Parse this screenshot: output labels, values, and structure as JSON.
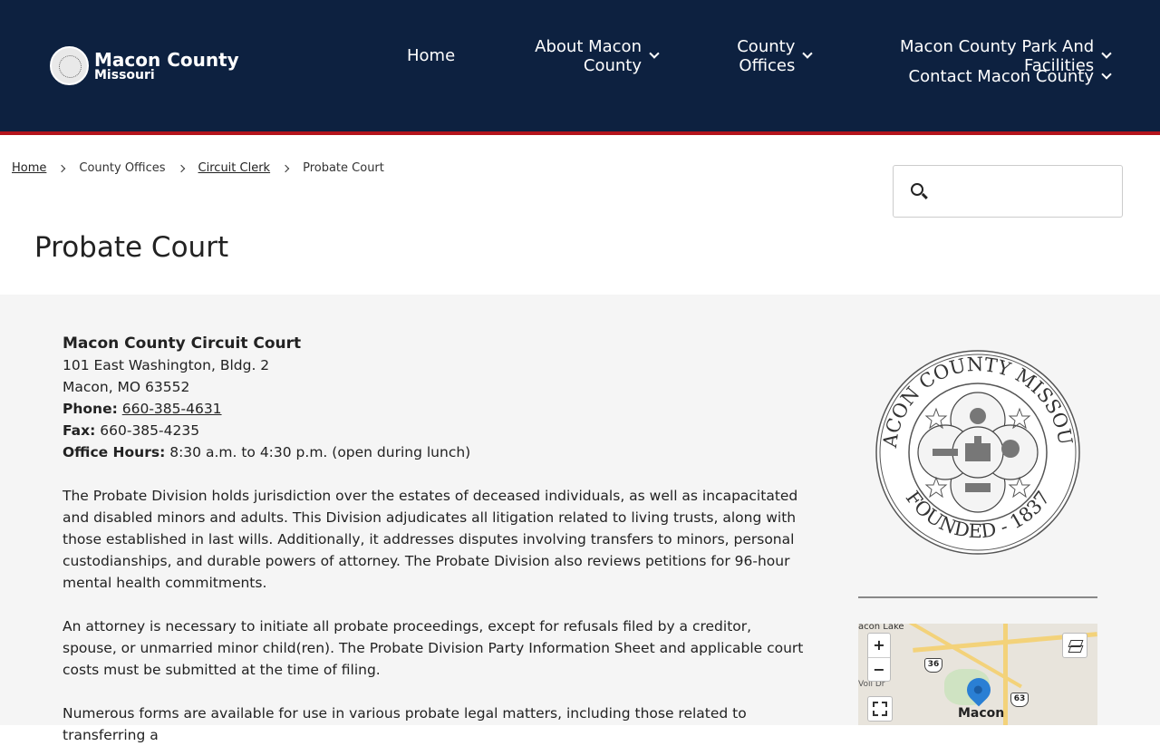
{
  "header": {
    "logo_title": "Macon County",
    "logo_sub": "Missouri",
    "nav_row1": [
      {
        "label": "Home",
        "dropdown": false
      },
      {
        "label": "About Macon County",
        "dropdown": true
      },
      {
        "label": "County Offices",
        "dropdown": true
      },
      {
        "label": "Macon County Park And Facilities",
        "dropdown": true
      }
    ],
    "nav_row2": [
      {
        "label": "Contact Macon County",
        "dropdown": true
      }
    ]
  },
  "breadcrumb": {
    "home": "Home",
    "county_offices": "County Offices",
    "circuit_clerk": "Circuit Clerk",
    "current": "Probate Court"
  },
  "search": {
    "placeholder": "",
    "value": ""
  },
  "page_title": "Probate Court",
  "court": {
    "name": "Macon County Circuit Court",
    "address1": "101 East Washington, Bldg. 2",
    "address2": "Macon, MO 63552",
    "phone_label": "Phone:",
    "phone": "660-385-4631",
    "fax_label": "Fax:",
    "fax": " 660-385-4235",
    "hours_label": "Office Hours:",
    "hours": " 8:30 a.m. to 4:30 p.m. (open during lunch)"
  },
  "paragraphs": [
    "The Probate Division holds jurisdiction over the estates of deceased individuals, as well as incapacitated and disabled minors and adults. This Division adjudicates all litigation related to living trusts, along with those established in last wills. Additionally, it addresses disputes involving transfers to minors, personal custodianships, and durable powers of attorney. The Probate Division also reviews petitions for 96-hour mental health commitments.",
    "An attorney is necessary to initiate all probate proceedings, except for refusals filed by a creditor, spouse, or unmarried minor child(ren). The Probate Division Party Information Sheet and applicable court costs must be submitted at the time of filing.",
    "Numerous forms are available for use in various probate legal matters, including those related to transferring a"
  ],
  "seal": {
    "top_text": "MACON COUNTY MISSOURI",
    "bottom_text": "FOUNDED - 1837"
  },
  "map": {
    "zoom_in": "+",
    "zoom_out": "−",
    "lake_label": "acon Lake",
    "city_label": "Macon",
    "vol_label": "Voll Dr",
    "route_36": "36",
    "route_63": "63"
  },
  "colors": {
    "header_bg": "#0d2140",
    "accent_stripe": "#b4141c",
    "content_bg": "#f5f5f5",
    "map_pin": "#2a7fd4"
  }
}
